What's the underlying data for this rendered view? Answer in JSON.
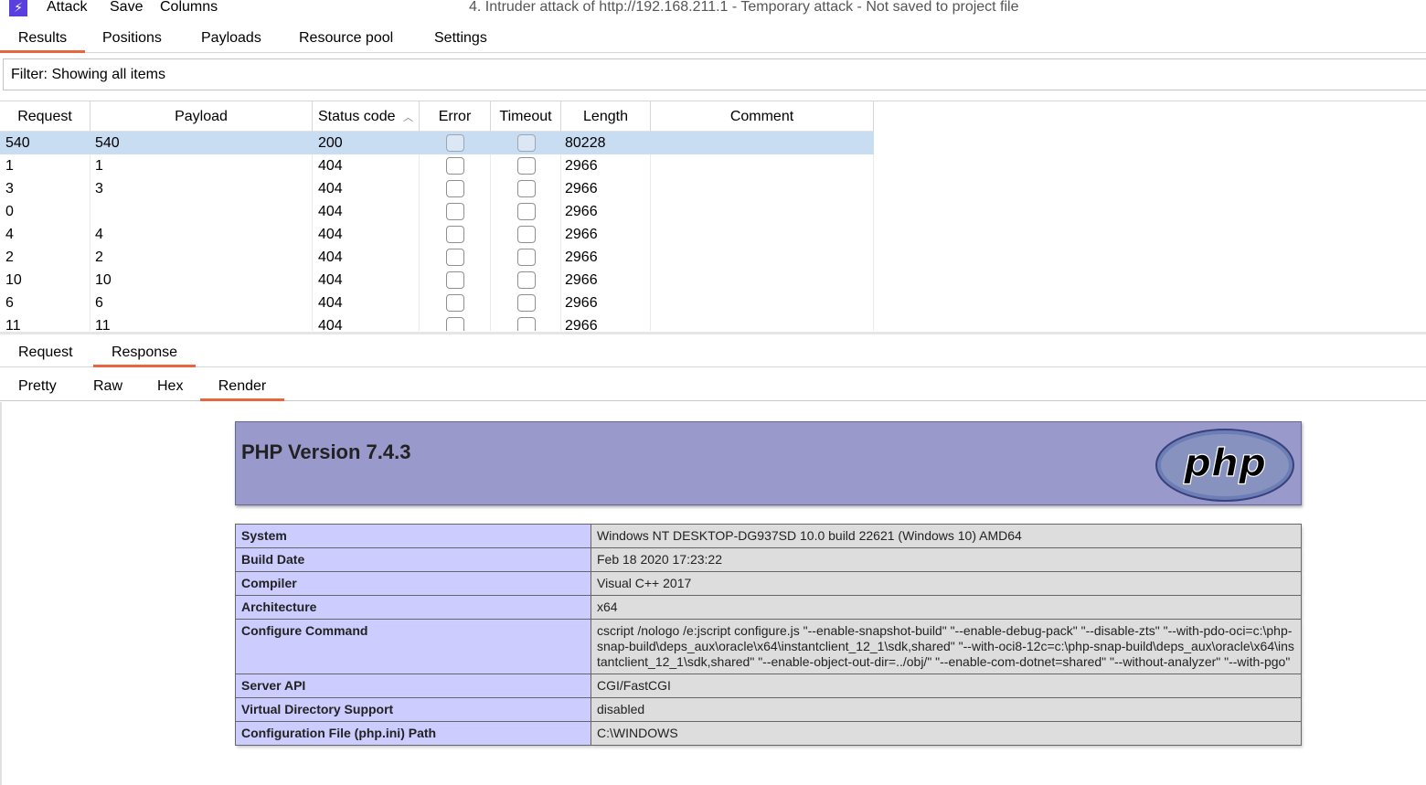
{
  "menubar": {
    "items": [
      "Attack",
      "Save",
      "Columns"
    ],
    "window_title": "4. Intruder attack of http://192.168.211.1 - Temporary attack - Not saved to project file",
    "app_icon": "lightning-icon"
  },
  "main_tabs": [
    {
      "label": "Results",
      "active": true
    },
    {
      "label": "Positions",
      "active": false
    },
    {
      "label": "Payloads",
      "active": false
    },
    {
      "label": "Resource pool",
      "active": false
    },
    {
      "label": "Settings",
      "active": false
    }
  ],
  "filter": {
    "text": "Filter: Showing all items"
  },
  "results": {
    "columns": [
      "Request",
      "Payload",
      "Status code",
      "Error",
      "Timeout",
      "Length",
      "Comment"
    ],
    "sort_column": "Status code",
    "sort_direction": "ascending",
    "rows": [
      {
        "request": "540",
        "payload": "540",
        "status": "200",
        "error": false,
        "timeout": false,
        "length": "80228",
        "comment": "",
        "selected": true
      },
      {
        "request": "1",
        "payload": "1",
        "status": "404",
        "error": false,
        "timeout": false,
        "length": "2966",
        "comment": "",
        "selected": false
      },
      {
        "request": "3",
        "payload": "3",
        "status": "404",
        "error": false,
        "timeout": false,
        "length": "2966",
        "comment": "",
        "selected": false
      },
      {
        "request": "0",
        "payload": "",
        "status": "404",
        "error": false,
        "timeout": false,
        "length": "2966",
        "comment": "",
        "selected": false
      },
      {
        "request": "4",
        "payload": "4",
        "status": "404",
        "error": false,
        "timeout": false,
        "length": "2966",
        "comment": "",
        "selected": false
      },
      {
        "request": "2",
        "payload": "2",
        "status": "404",
        "error": false,
        "timeout": false,
        "length": "2966",
        "comment": "",
        "selected": false
      },
      {
        "request": "10",
        "payload": "10",
        "status": "404",
        "error": false,
        "timeout": false,
        "length": "2966",
        "comment": "",
        "selected": false
      },
      {
        "request": "6",
        "payload": "6",
        "status": "404",
        "error": false,
        "timeout": false,
        "length": "2966",
        "comment": "",
        "selected": false
      },
      {
        "request": "11",
        "payload": "11",
        "status": "404",
        "error": false,
        "timeout": false,
        "length": "2966",
        "comment": "",
        "selected": false
      }
    ]
  },
  "message_tabs": [
    {
      "label": "Request",
      "active": false
    },
    {
      "label": "Response",
      "active": true
    }
  ],
  "view_tabs": [
    {
      "label": "Pretty",
      "active": false
    },
    {
      "label": "Raw",
      "active": false
    },
    {
      "label": "Hex",
      "active": false
    },
    {
      "label": "Render",
      "active": true
    }
  ],
  "render": {
    "php_version": "PHP Version 7.4.3",
    "logo_text": "php",
    "header_color": "#9999cc",
    "key_color": "#ccccff",
    "value_color": "#dddddd",
    "info": [
      {
        "key": "System",
        "value": "Windows NT DESKTOP-DG937SD 10.0 build 22621 (Windows 10) AMD64"
      },
      {
        "key": "Build Date",
        "value": "Feb 18 2020 17:23:22"
      },
      {
        "key": "Compiler",
        "value": "Visual C++ 2017"
      },
      {
        "key": "Architecture",
        "value": "x64"
      },
      {
        "key": "Configure Command",
        "value": "cscript /nologo /e:jscript configure.js \"--enable-snapshot-build\" \"--enable-debug-pack\" \"--disable-zts\" \"--with-pdo-oci=c:\\php-snap-build\\deps_aux\\oracle\\x64\\instantclient_12_1\\sdk,shared\" \"--with-oci8-12c=c:\\php-snap-build\\deps_aux\\oracle\\x64\\instantclient_12_1\\sdk,shared\" \"--enable-object-out-dir=../obj/\" \"--enable-com-dotnet=shared\" \"--without-analyzer\" \"--with-pgo\""
      },
      {
        "key": "Server API",
        "value": "CGI/FastCGI"
      },
      {
        "key": "Virtual Directory Support",
        "value": "disabled"
      },
      {
        "key": "Configuration File (php.ini) Path",
        "value": "C:\\WINDOWS"
      }
    ]
  },
  "accent_color": "#e8663d",
  "selection_color": "#c8dcf2"
}
